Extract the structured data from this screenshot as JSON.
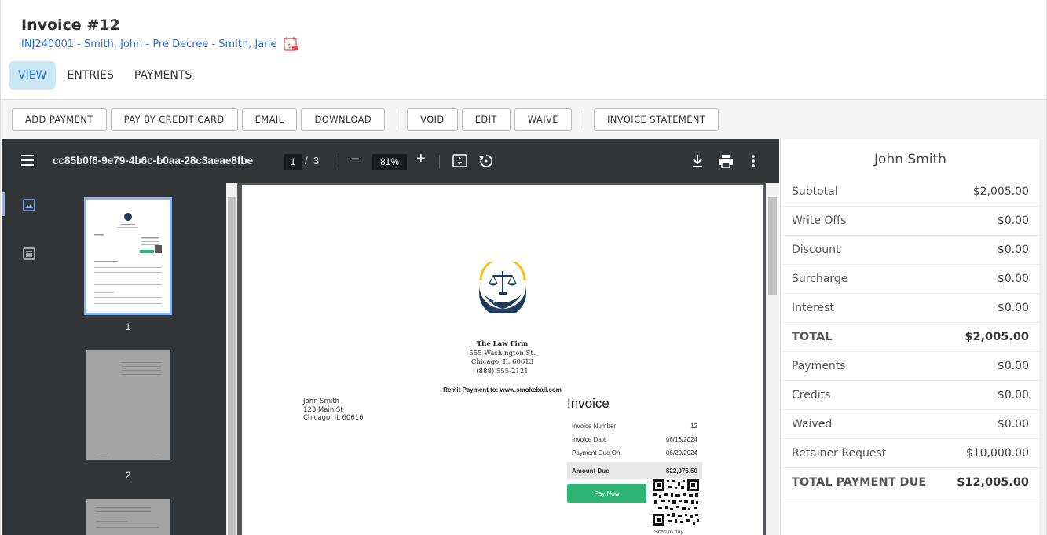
{
  "header": {
    "title": "Invoice #12",
    "matter_link": "INJ240001 - Smith, John - Pre Decree - Smith, Jane"
  },
  "tabs": [
    {
      "label": "VIEW",
      "active": true
    },
    {
      "label": "ENTRIES",
      "active": false
    },
    {
      "label": "PAYMENTS",
      "active": false
    }
  ],
  "toolbar": {
    "add_payment": "ADD PAYMENT",
    "pay_by_credit_card": "PAY BY CREDIT CARD",
    "email": "EMAIL",
    "download": "DOWNLOAD",
    "void": "VOID",
    "edit": "EDIT",
    "waive": "WAIVE",
    "invoice_statement": "INVOICE STATEMENT"
  },
  "pdf_viewer": {
    "file_name": "cc85b0f6-9e79-4b6c-b0aa-28c3aeae8fbe",
    "current_page": "1",
    "page_separator": "/",
    "total_pages": "3",
    "zoom": "81%",
    "thumbnails": [
      "1",
      "2"
    ]
  },
  "document": {
    "firm_name": "The Law Firm",
    "firm_street": "555 Washington St.",
    "firm_city": "Chicago, IL 60613",
    "firm_phone": "(888) 555-2121",
    "remit": "Remit Payment to: www.smokeball.com",
    "client_name": "John Smith",
    "client_street": "123 Main St",
    "client_city": "Chicago, IL 60616",
    "invoice_heading": "Invoice",
    "invoice_number_label": "Invoice Number",
    "invoice_number": "12",
    "invoice_date_label": "Invoice Date",
    "invoice_date": "06/13/2024",
    "due_on_label": "Payment Due On",
    "due_on": "06/20/2024",
    "amount_due_label": "Amount Due",
    "amount_due": "$22,976.50",
    "pay_now": "Pay Now",
    "scan": "Scan to pay"
  },
  "summary": {
    "client_name": "John Smith",
    "rows": [
      {
        "label": "Subtotal",
        "value": "$2,005.00"
      },
      {
        "label": "Write Offs",
        "value": "$0.00"
      },
      {
        "label": "Discount",
        "value": "$0.00"
      },
      {
        "label": "Surcharge",
        "value": "$0.00"
      },
      {
        "label": "Interest",
        "value": "$0.00"
      },
      {
        "label": "TOTAL",
        "value": "$2,005.00"
      },
      {
        "label": "Payments",
        "value": "$0.00"
      },
      {
        "label": "Credits",
        "value": "$0.00"
      },
      {
        "label": "Waived",
        "value": "$0.00"
      },
      {
        "label": "Retainer Request",
        "value": "$10,000.00"
      },
      {
        "label": "TOTAL PAYMENT DUE",
        "value": "$12,005.00"
      }
    ]
  },
  "colors": {
    "link": "#2f6fc9",
    "tab_active_bg": "#c9e8f4",
    "pay_now": "#2db474",
    "viewer_bg": "#525659",
    "viewer_toolbar": "#323639"
  }
}
